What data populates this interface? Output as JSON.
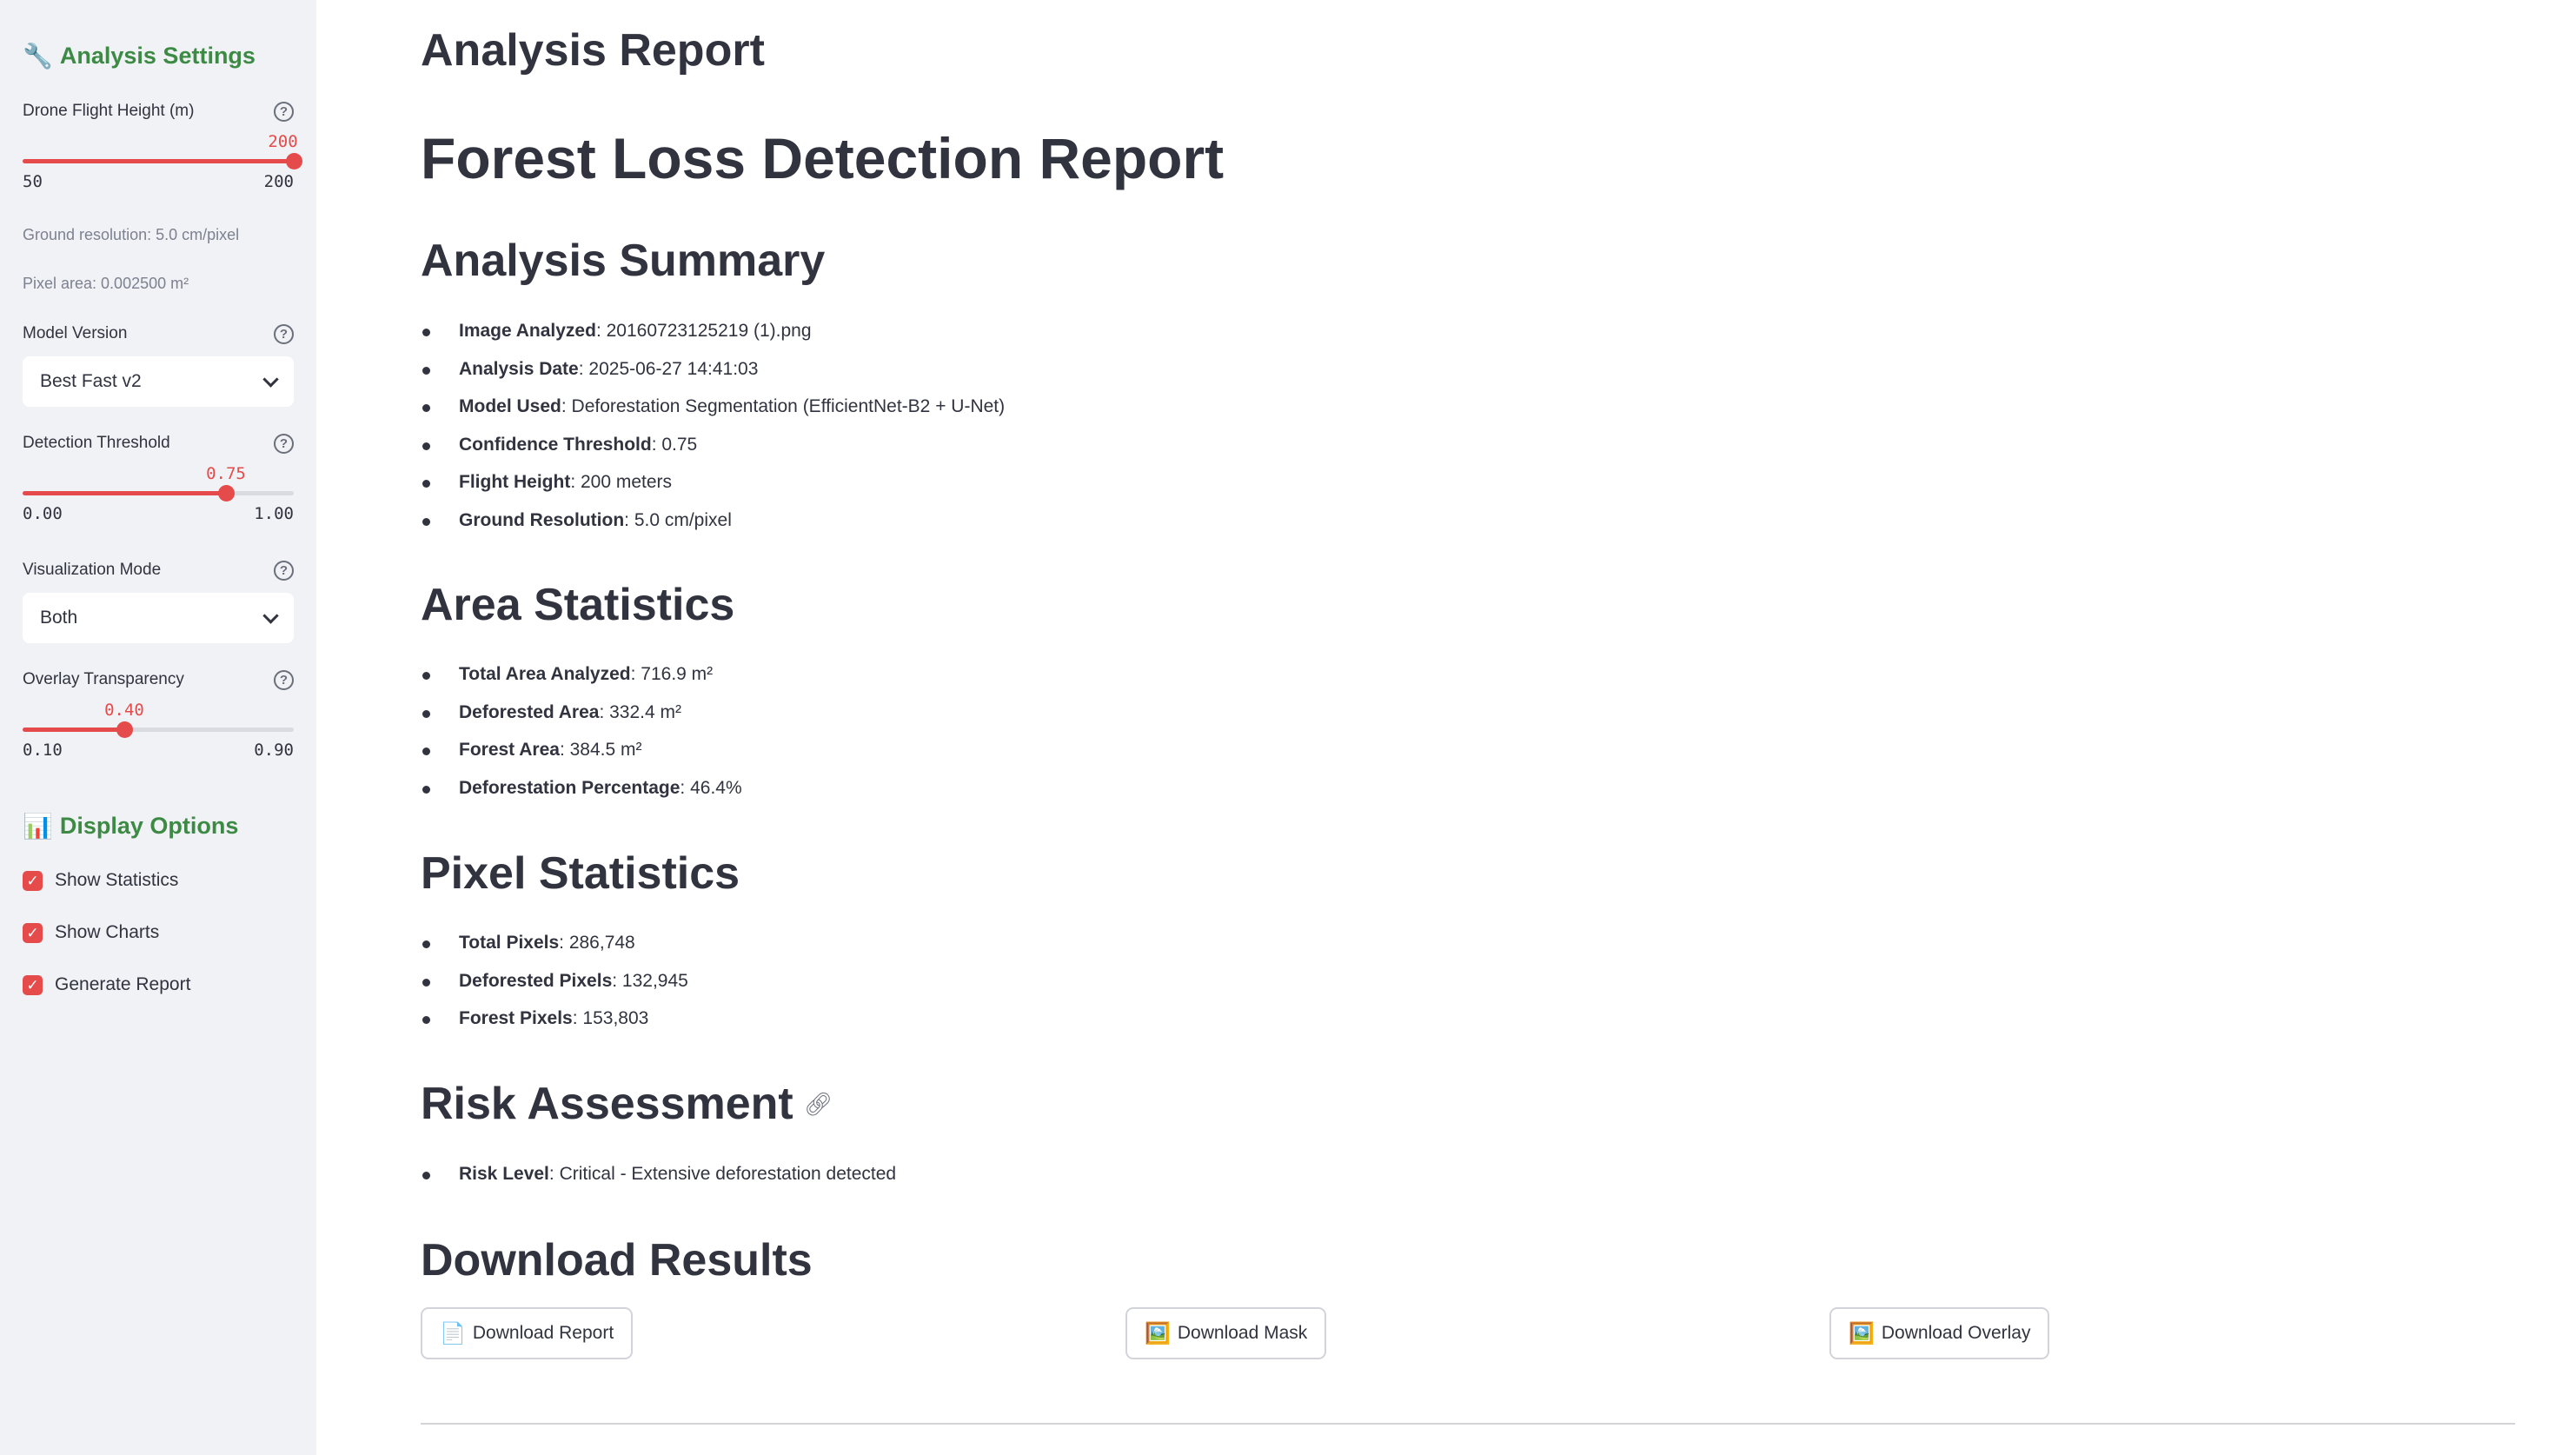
{
  "sidebar": {
    "analysis_header": {
      "icon": "wrench-icon",
      "emoji": "🔧",
      "label": "Analysis Settings"
    },
    "flight_height": {
      "label": "Drone Flight Height (m)",
      "value": "200",
      "min": "50",
      "max": "200",
      "fraction": 1.0
    },
    "ground_resolution": "Ground resolution: 5.0 cm/pixel",
    "pixel_area": "Pixel area: 0.002500 m²",
    "model_version": {
      "label": "Model Version",
      "value": "Best Fast v2"
    },
    "detection_threshold": {
      "label": "Detection Threshold",
      "value": "0.75",
      "min": "0.00",
      "max": "1.00",
      "fraction": 0.75
    },
    "visualization_mode": {
      "label": "Visualization Mode",
      "value": "Both"
    },
    "overlay_transparency": {
      "label": "Overlay Transparency",
      "value": "0.40",
      "min": "0.10",
      "max": "0.90",
      "fraction": 0.375
    },
    "display_header": {
      "icon": "bar-chart-icon",
      "emoji": "📊",
      "label": "Display Options"
    },
    "checkboxes": [
      {
        "label": "Show Statistics",
        "checked": true
      },
      {
        "label": "Show Charts",
        "checked": true
      },
      {
        "label": "Generate Report",
        "checked": true
      }
    ]
  },
  "main": {
    "page_title": "Analysis Report",
    "report_title": "Forest Loss Detection Report",
    "summary": {
      "heading": "Analysis Summary",
      "items": [
        {
          "key": "Image Analyzed",
          "value": ": 20160723125219 (1).png"
        },
        {
          "key": "Analysis Date",
          "value": ": 2025-06-27 14:41:03"
        },
        {
          "key": "Model Used",
          "value": ": Deforestation Segmentation (EfficientNet-B2 + U-Net)"
        },
        {
          "key": "Confidence Threshold",
          "value": ": 0.75"
        },
        {
          "key": "Flight Height",
          "value": ": 200 meters"
        },
        {
          "key": "Ground Resolution",
          "value": ": 5.0 cm/pixel"
        }
      ]
    },
    "area": {
      "heading": "Area Statistics",
      "items": [
        {
          "key": "Total Area Analyzed",
          "value": ": 716.9 m²"
        },
        {
          "key": "Deforested Area",
          "value": ": 332.4 m²"
        },
        {
          "key": "Forest Area",
          "value": ": 384.5 m²"
        },
        {
          "key": "Deforestation Percentage",
          "value": ": 46.4%"
        }
      ]
    },
    "pixel": {
      "heading": "Pixel Statistics",
      "items": [
        {
          "key": "Total Pixels",
          "value": ": 286,748"
        },
        {
          "key": "Deforested Pixels",
          "value": ": 132,945"
        },
        {
          "key": "Forest Pixels",
          "value": ": 153,803"
        }
      ]
    },
    "risk": {
      "heading": "Risk Assessment",
      "link_icon": "link-icon",
      "items": [
        {
          "key": "Risk Level",
          "value": ": Critical - Extensive deforestation detected"
        }
      ]
    },
    "download": {
      "heading": "Download Results",
      "buttons": [
        {
          "icon": "document-icon",
          "emoji": "📄",
          "label": "Download Report"
        },
        {
          "icon": "image-icon",
          "emoji": "🖼️",
          "label": "Download Mask"
        },
        {
          "icon": "image-icon",
          "emoji": "🖼️",
          "label": "Download Overlay"
        }
      ]
    }
  },
  "colors": {
    "accent": "#e64b4b",
    "sidebar_header": "#3d8a44",
    "sidebar_bg": "#f0f2f6",
    "text": "#31333f"
  }
}
